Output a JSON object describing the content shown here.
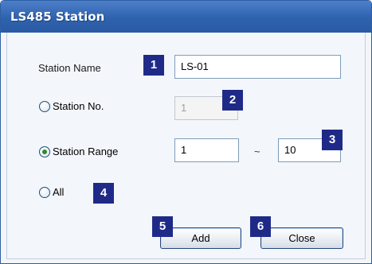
{
  "window": {
    "title": "LS485 Station"
  },
  "form": {
    "station_name_label": "Station Name",
    "station_name_value": "LS-01",
    "station_no_label": "Station No.",
    "station_no_value": "1",
    "station_range_label": "Station Range",
    "range_from_value": "1",
    "range_separator": "~",
    "range_to_value": "10",
    "all_label": "All",
    "selected_option": "Station Range"
  },
  "buttons": {
    "add_label": "Add",
    "close_label": "Close"
  },
  "badges": [
    "1",
    "2",
    "3",
    "4",
    "5",
    "6"
  ],
  "colors": {
    "titlebar": "#2f62ad",
    "badge": "#1f2a88",
    "radio_checked": "#2f8a2f"
  }
}
